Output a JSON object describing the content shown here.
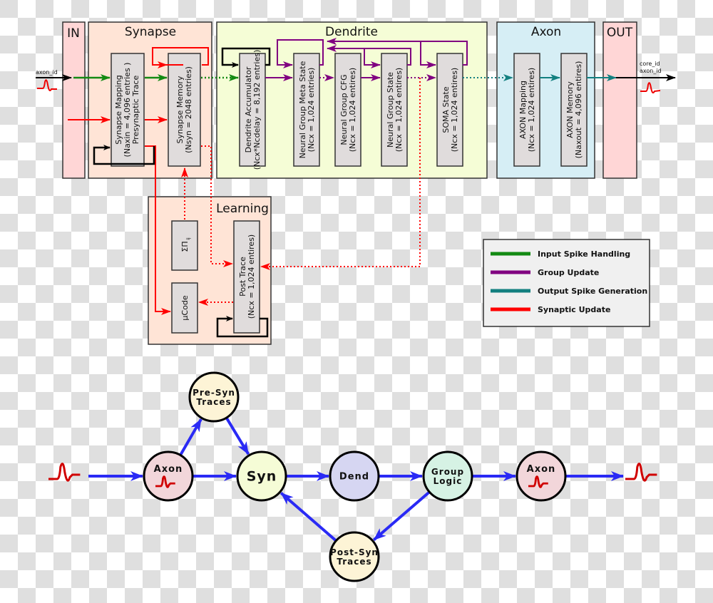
{
  "colors": {
    "input_spike": "#138a13",
    "group_update": "#800080",
    "output_spike": "#138080",
    "synaptic_update": "#ff0000",
    "flow": "#2a2af5",
    "spike": "#d00000"
  },
  "top_diagram": {
    "sections": {
      "in": "IN",
      "synapse": "Synapse",
      "dendrite": "Dendrite",
      "axon": "Axon",
      "out": "OUT",
      "learning": "Learning"
    },
    "input_label": "axon_id",
    "output_labels": [
      "core_id",
      "axon_id"
    ],
    "blocks": {
      "synapse_mapping": [
        "Synapse Mapping",
        "(Naxin = 4,096 entries )",
        "Presynaptic Trace"
      ],
      "synapse_memory": [
        "Synapse Memory",
        "(Nsyn = 2048 entries)"
      ],
      "dendrite_accumulator": [
        "Dendrite Accumulator",
        "(Ncx*Ncdelay = 8,192 entries)"
      ],
      "neural_group_meta_state": [
        "Neural Group Meta State",
        "(Ncx = 1,024 entries)"
      ],
      "neural_group_cfg": [
        "Neural Group CFG",
        "(Ncx = 1,024 entires)"
      ],
      "neural_group_state": [
        "Neural Group State",
        "(Ncx = 1,024 entires)"
      ],
      "soma_state": [
        "SOMA State",
        "(Ncx = 1,024 entires)"
      ],
      "axon_mapping": [
        "AXON Mapping",
        "(Ncx = 1,024 entires)"
      ],
      "axon_memory": [
        "AXON Memory",
        "(Naxout = 4,096 entires)"
      ],
      "sum_product": "ΣΠ",
      "sum_product_sub": "ij",
      "ucode": "µCode",
      "post_trace": [
        "Post Trace",
        "(Ncx = 1,024 entires)"
      ]
    },
    "legend": [
      {
        "label": "Input Spike Handling",
        "color": "#138a13"
      },
      {
        "label": "Group Update",
        "color": "#800080"
      },
      {
        "label": "Output Spike Generation",
        "color": "#138080"
      },
      {
        "label": "Synaptic Update",
        "color": "#ff0000"
      }
    ]
  },
  "bottom_diagram": {
    "nodes": {
      "axon_in": "Axon",
      "pre_syn": [
        "Pre-Syn",
        "Traces"
      ],
      "syn": "Syn",
      "dend": "Dend",
      "group_logic": [
        "Group",
        "Logic"
      ],
      "axon_out": "Axon",
      "post_syn": [
        "Post-Syn",
        "Traces"
      ]
    },
    "edges": [
      [
        "spike_in",
        "axon_in"
      ],
      [
        "axon_in",
        "syn"
      ],
      [
        "axon_in",
        "pre_syn"
      ],
      [
        "pre_syn",
        "syn"
      ],
      [
        "syn",
        "dend"
      ],
      [
        "dend",
        "group_logic"
      ],
      [
        "group_logic",
        "axon_out"
      ],
      [
        "axon_out",
        "spike_out"
      ],
      [
        "group_logic",
        "post_syn"
      ],
      [
        "post_syn",
        "syn"
      ]
    ]
  }
}
